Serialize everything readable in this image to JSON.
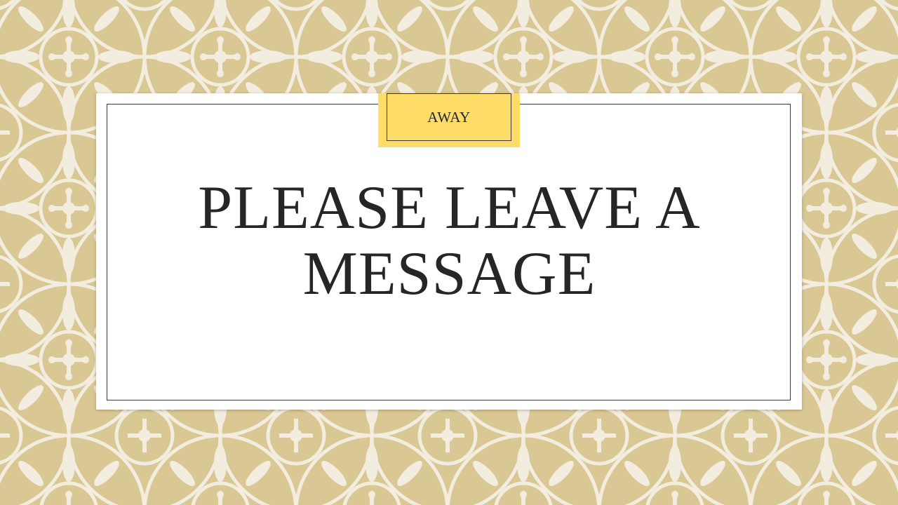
{
  "slide": {
    "tag_label": "AWAY",
    "title": "PLEASE LEAVE A MESSAGE"
  },
  "colors": {
    "pattern_background": "#d9c794",
    "pattern_motif": "#f3ede0",
    "card": "#ffffff",
    "tag": "#fddc67",
    "text": "#262626"
  },
  "background": {
    "icon": "floral-damask-pattern-icon"
  }
}
